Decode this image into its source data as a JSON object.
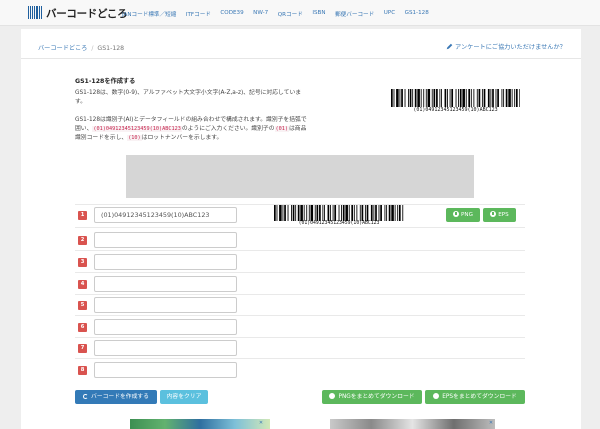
{
  "nav": {
    "brand": "バーコードどころ",
    "links": [
      "JANコード標準／短縮",
      "ITFコード",
      "CODE39",
      "NW-7",
      "QRコード",
      "ISBN",
      "郵便バーコード",
      "UPC",
      "GS1-128"
    ]
  },
  "breadcrumb": {
    "home": "バーコードどころ",
    "sep": "/",
    "current": "GS1-128"
  },
  "survey_link": "アンケートにご協力いただけませんか？",
  "intro": {
    "title": "GS1-128を作成する",
    "p1": "GS1-128は、数字(0-9)、アルファベット大文字小文字(A-Z,a-z)、記号に対応しています。",
    "p2a": "GS1-128は識別子(AI)とデータフィールドの組み合わせで構成されます。識別子を括弧で囲い、",
    "p2_code1": "(01)04912345123459(10)ABC123",
    "p2b": "のようにご入力ください。識別子の",
    "p2_code2": "(01)",
    "p2c": "は商品識別コードを示し、",
    "p2_code3": "(10)",
    "p2d": "はロットナンバーを示します。"
  },
  "sample_barcode_text": "(01)04912345123459(10)ABC123",
  "rows": [
    {
      "num": "1",
      "value": "(01)04912345123459(10)ABC123"
    },
    {
      "num": "2",
      "value": ""
    },
    {
      "num": "3",
      "value": ""
    },
    {
      "num": "4",
      "value": ""
    },
    {
      "num": "5",
      "value": ""
    },
    {
      "num": "6",
      "value": ""
    },
    {
      "num": "7",
      "value": ""
    },
    {
      "num": "8",
      "value": ""
    }
  ],
  "row1_barcode_text": "(01)04912345123459(10)ABC123",
  "row1_buttons": {
    "png": "PNG",
    "eps": "EPS"
  },
  "actions": {
    "create": "バーコードを作成する",
    "clear": "内容をクリア",
    "png_all": "PNGをまとめてダウンロード",
    "eps_all": "EPSをまとめてダウンロード"
  },
  "ad_close": "✕",
  "colors": {
    "accent": "#337ab7",
    "success": "#5cb85c",
    "danger": "#d9534f",
    "info": "#5bc0de",
    "link": "#3a78b5"
  }
}
